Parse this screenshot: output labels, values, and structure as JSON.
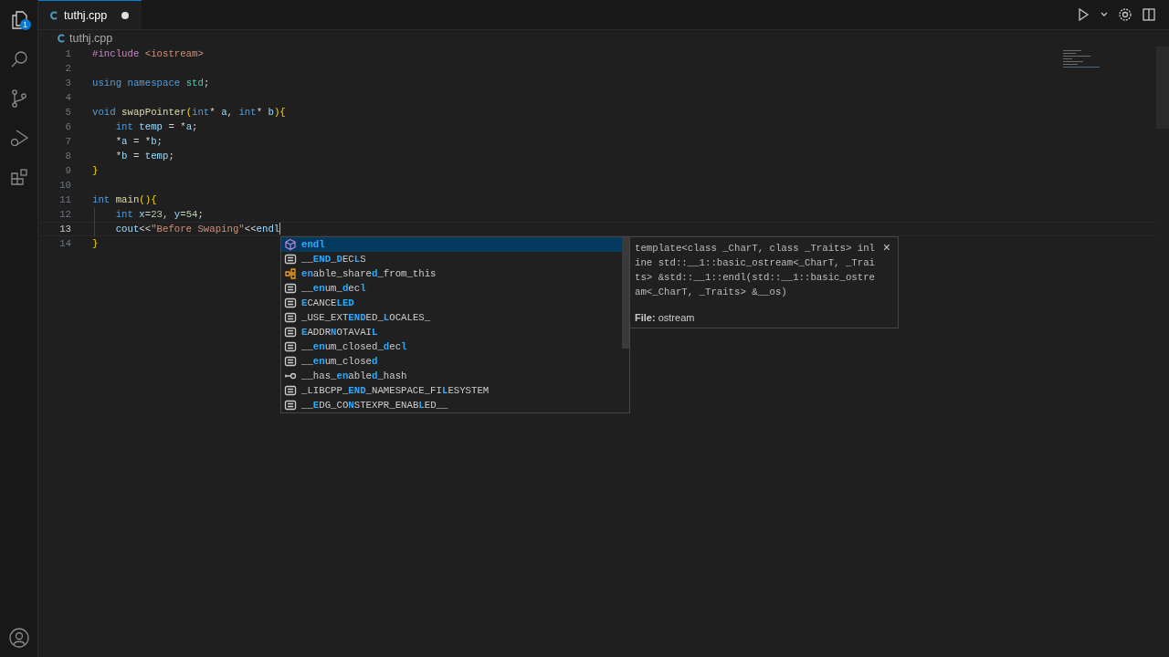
{
  "activity_bar": {
    "badge": "1"
  },
  "tabs": [
    {
      "label": "tuthj.cpp",
      "selected": true,
      "modified": true
    }
  ],
  "breadcrumb": "tuthj.cpp",
  "editor": {
    "lines": [
      {
        "number": "1",
        "current": false,
        "tokens": [
          {
            "kind": "pre",
            "text": "#include"
          },
          {
            "kind": "str",
            "text": " <iostream>"
          }
        ]
      },
      {
        "number": "2",
        "current": false
      },
      {
        "number": "3",
        "current": false,
        "tokens": [
          {
            "kind": "kw",
            "text": "using"
          },
          {
            "kind": "kw",
            "text": " namespace"
          },
          {
            "kind": "type",
            "text": " std"
          },
          {
            "kind": "plain",
            "text": ";"
          }
        ]
      },
      {
        "number": "4",
        "current": false
      },
      {
        "number": "5",
        "current": false,
        "tokens": [
          {
            "kind": "kw",
            "text": "void"
          },
          {
            "kind": "fn",
            "text": " swapPointer"
          },
          {
            "kind": "brace",
            "text": "("
          },
          {
            "kind": "kw",
            "text": "int"
          },
          {
            "kind": "plain",
            "text": "* "
          },
          {
            "kind": "var",
            "text": "a"
          },
          {
            "kind": "plain",
            "text": ", "
          },
          {
            "kind": "kw",
            "text": "int"
          },
          {
            "kind": "plain",
            "text": "* "
          },
          {
            "kind": "var",
            "text": "b"
          },
          {
            "kind": "brace",
            "text": "){"
          }
        ]
      },
      {
        "number": "6",
        "current": false,
        "tokens": [
          {
            "kind": "kw",
            "text": "    int"
          },
          {
            "kind": "var",
            "text": " temp"
          },
          {
            "kind": "plain",
            "text": " = *"
          },
          {
            "kind": "var",
            "text": "a"
          },
          {
            "kind": "plain",
            "text": ";"
          }
        ]
      },
      {
        "number": "7",
        "current": false,
        "tokens": [
          {
            "kind": "plain",
            "text": "    *"
          },
          {
            "kind": "var",
            "text": "a"
          },
          {
            "kind": "plain",
            "text": " = *"
          },
          {
            "kind": "var",
            "text": "b"
          },
          {
            "kind": "plain",
            "text": ";"
          }
        ]
      },
      {
        "number": "8",
        "current": false,
        "tokens": [
          {
            "kind": "plain",
            "text": "    *"
          },
          {
            "kind": "var",
            "text": "b"
          },
          {
            "kind": "plain",
            "text": " = "
          },
          {
            "kind": "var",
            "text": "temp"
          },
          {
            "kind": "plain",
            "text": ";"
          }
        ]
      },
      {
        "number": "9",
        "current": false,
        "tokens": [
          {
            "kind": "brace",
            "text": "}"
          }
        ]
      },
      {
        "number": "10",
        "current": false
      },
      {
        "number": "11",
        "current": false,
        "tokens": [
          {
            "kind": "kw",
            "text": "int"
          },
          {
            "kind": "fn",
            "text": " main"
          },
          {
            "kind": "brace",
            "text": "(){"
          }
        ]
      },
      {
        "number": "12",
        "current": false,
        "tokens": [
          {
            "kind": "kw",
            "text": "    int"
          },
          {
            "kind": "var",
            "text": " x"
          },
          {
            "kind": "plain",
            "text": "="
          },
          {
            "kind": "num",
            "text": "23"
          },
          {
            "kind": "plain",
            "text": ", "
          },
          {
            "kind": "var",
            "text": "y"
          },
          {
            "kind": "plain",
            "text": "="
          },
          {
            "kind": "num",
            "text": "54"
          },
          {
            "kind": "plain",
            "text": ";"
          }
        ]
      },
      {
        "number": "13",
        "current": true,
        "tokens": [
          {
            "kind": "var",
            "text": "    cout"
          },
          {
            "kind": "plain",
            "text": "<<"
          },
          {
            "kind": "str",
            "text": "\"Before Swaping\""
          },
          {
            "kind": "plain",
            "text": "<<"
          },
          {
            "kind": "var",
            "text": "endl"
          }
        ]
      },
      {
        "number": "14",
        "current": false,
        "tokens": [
          {
            "kind": "brace",
            "text": "}"
          }
        ]
      }
    ]
  },
  "suggestions": [
    {
      "kind": "function",
      "selected": true,
      "parts": [
        {
          "t": "endl",
          "match": true
        }
      ]
    },
    {
      "kind": "macro",
      "selected": false,
      "parts": [
        {
          "t": "__",
          "match": false
        },
        {
          "t": "END",
          "match": true
        },
        {
          "t": "_",
          "match": false
        },
        {
          "t": "D",
          "match": true
        },
        {
          "t": "EC",
          "match": false
        },
        {
          "t": "L",
          "match": true
        },
        {
          "t": "S",
          "match": false
        }
      ]
    },
    {
      "kind": "class",
      "selected": false,
      "parts": [
        {
          "t": "en",
          "match": true
        },
        {
          "t": "able_share",
          "match": false
        },
        {
          "t": "d",
          "match": true
        },
        {
          "t": "_from_this",
          "match": false
        }
      ]
    },
    {
      "kind": "macro",
      "selected": false,
      "parts": [
        {
          "t": "__",
          "match": false
        },
        {
          "t": "en",
          "match": true
        },
        {
          "t": "um_",
          "match": false
        },
        {
          "t": "d",
          "match": true
        },
        {
          "t": "ec",
          "match": false
        },
        {
          "t": "l",
          "match": true
        }
      ]
    },
    {
      "kind": "macro",
      "selected": false,
      "parts": [
        {
          "t": "E",
          "match": true
        },
        {
          "t": "CANCE",
          "match": false
        },
        {
          "t": "LED",
          "match": true
        }
      ]
    },
    {
      "kind": "macro",
      "selected": false,
      "parts": [
        {
          "t": "_USE_EXT",
          "match": false
        },
        {
          "t": "END",
          "match": true
        },
        {
          "t": "ED_",
          "match": false
        },
        {
          "t": "L",
          "match": true
        },
        {
          "t": "OCALES_",
          "match": false
        }
      ]
    },
    {
      "kind": "macro",
      "selected": false,
      "parts": [
        {
          "t": "E",
          "match": true
        },
        {
          "t": "ADDR",
          "match": false
        },
        {
          "t": "N",
          "match": true
        },
        {
          "t": "OTAVAI",
          "match": false
        },
        {
          "t": "L",
          "match": true
        }
      ]
    },
    {
      "kind": "macro",
      "selected": false,
      "parts": [
        {
          "t": "__",
          "match": false
        },
        {
          "t": "en",
          "match": true
        },
        {
          "t": "um_closed_",
          "match": false
        },
        {
          "t": "d",
          "match": true
        },
        {
          "t": "ec",
          "match": false
        },
        {
          "t": "l",
          "match": true
        }
      ]
    },
    {
      "kind": "macro",
      "selected": false,
      "parts": [
        {
          "t": "__",
          "match": false
        },
        {
          "t": "en",
          "match": true
        },
        {
          "t": "um_close",
          "match": false
        },
        {
          "t": "d",
          "match": true
        }
      ]
    },
    {
      "kind": "field",
      "selected": false,
      "parts": [
        {
          "t": "__has_",
          "match": false
        },
        {
          "t": "en",
          "match": true
        },
        {
          "t": "able",
          "match": false
        },
        {
          "t": "d",
          "match": true
        },
        {
          "t": "_hash",
          "match": false
        }
      ]
    },
    {
      "kind": "macro",
      "selected": false,
      "parts": [
        {
          "t": "_LIBCPP_",
          "match": false
        },
        {
          "t": "END",
          "match": true
        },
        {
          "t": "_NAMESPACE_FI",
          "match": false
        },
        {
          "t": "L",
          "match": true
        },
        {
          "t": "ESYSTEM",
          "match": false
        }
      ]
    },
    {
      "kind": "macro",
      "selected": false,
      "parts": [
        {
          "t": "__",
          "match": false
        },
        {
          "t": "E",
          "match": true
        },
        {
          "t": "DG_CO",
          "match": false
        },
        {
          "t": "N",
          "match": true
        },
        {
          "t": "STEXPR_ENAB",
          "match": false
        },
        {
          "t": "L",
          "match": true
        },
        {
          "t": "ED__",
          "match": false
        }
      ]
    }
  ],
  "detail": {
    "signature": "template<class _CharT, class _Traits> inline std::__1::basic_ostream<_CharT, _Traits> &std::__1::endl(std::__1::basic_ostream<_CharT, _Traits> &__os)",
    "file": "**File:** ostream",
    "close": "×"
  }
}
